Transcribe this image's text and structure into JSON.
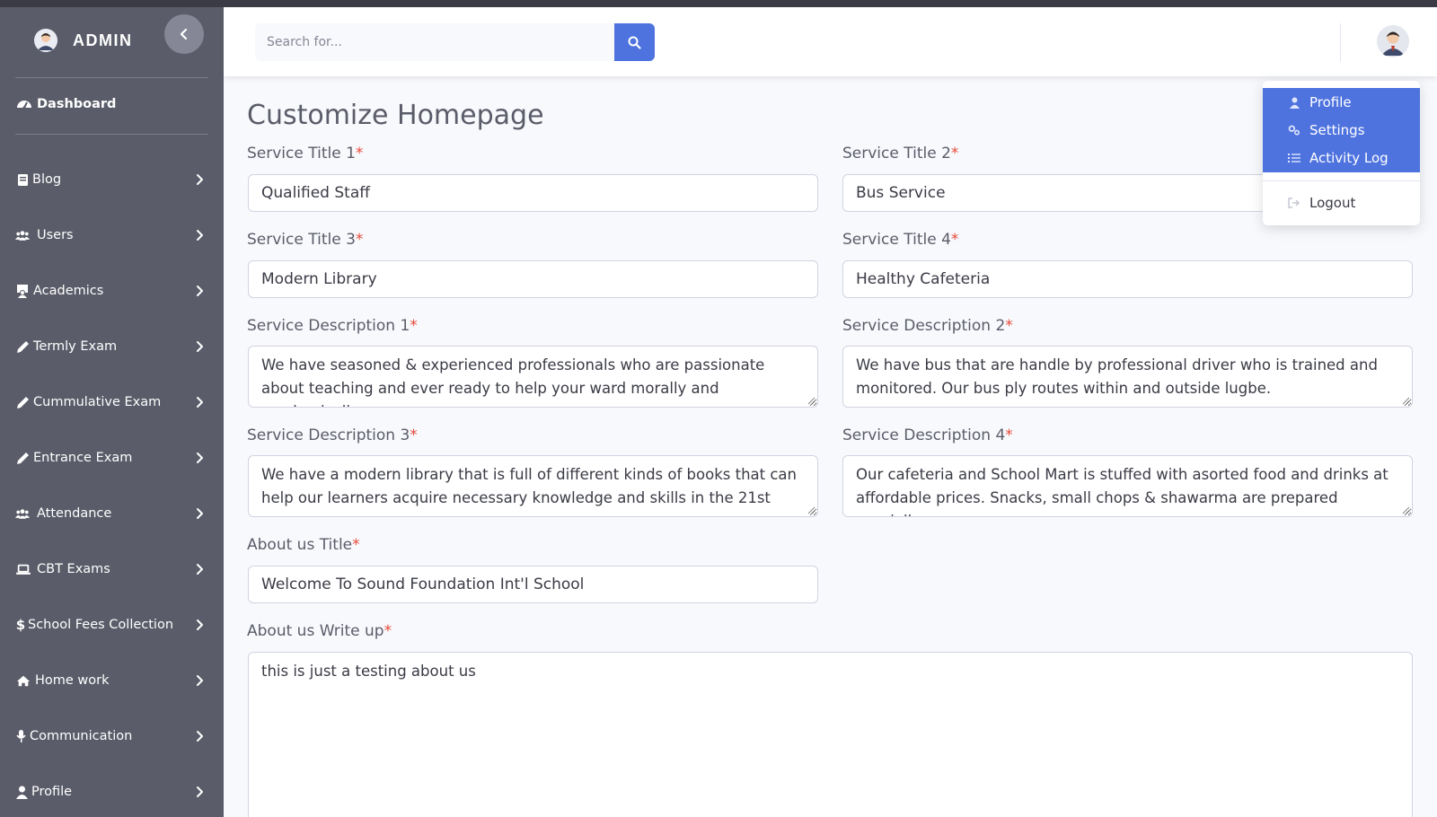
{
  "sidebar": {
    "brand": "ADMIN",
    "dashboard": "Dashboard",
    "items": [
      {
        "label": "Blog",
        "icon": "book-icon"
      },
      {
        "label": "Users",
        "icon": "users-icon"
      },
      {
        "label": "Academics",
        "icon": "teacher-icon"
      },
      {
        "label": "Termly Exam",
        "icon": "pencil-icon"
      },
      {
        "label": "Cummulative Exam",
        "icon": "pencil-icon"
      },
      {
        "label": "Entrance Exam",
        "icon": "pencil-icon"
      },
      {
        "label": "Attendance",
        "icon": "users-icon"
      },
      {
        "label": "CBT Exams",
        "icon": "laptop-icon"
      },
      {
        "label": "School Fees Collection",
        "icon": "dollar-icon"
      },
      {
        "label": "Home work",
        "icon": "home-icon"
      },
      {
        "label": "Communication",
        "icon": "microphone-icon"
      },
      {
        "label": "Profile",
        "icon": "user-icon"
      }
    ]
  },
  "topbar": {
    "search_placeholder": "Search for..."
  },
  "user_menu": {
    "items": [
      {
        "label": "Profile",
        "icon": "user-icon"
      },
      {
        "label": "Settings",
        "icon": "cogs-icon"
      },
      {
        "label": "Activity Log",
        "icon": "list-icon"
      }
    ],
    "logout": "Logout"
  },
  "main": {
    "title": "Customize Homepage",
    "required_mark": "*",
    "fields": {
      "service_title_1": {
        "label": "Service Title 1",
        "value": "Qualified Staff"
      },
      "service_title_2": {
        "label": "Service Title 2",
        "value": "Bus Service"
      },
      "service_title_3": {
        "label": "Service Title 3",
        "value": "Modern Library"
      },
      "service_title_4": {
        "label": "Service Title 4",
        "value": "Healthy Cafeteria"
      },
      "service_desc_1": {
        "label": "Service Description 1",
        "value": "We have seasoned & experienced professionals who are passionate about teaching and ever ready to help your ward morally and academically"
      },
      "service_desc_2": {
        "label": "Service Description 2",
        "value": "We have bus that are handle by professional driver who is trained and monitored. Our bus ply routes within and outside lugbe."
      },
      "service_desc_3": {
        "label": "Service Description 3",
        "value": "We have a modern library that is full of different kinds of books that can help our learners acquire necessary knowledge and skills in the 21st"
      },
      "service_desc_4": {
        "label": "Service Description 4",
        "value": "Our cafeteria and School Mart is stuffed with asorted food and drinks at affordable prices. Snacks, small chops & shawarma are prepared specially."
      },
      "about_title": {
        "label": "About us Title",
        "value": "Welcome To Sound Foundation Int'l School"
      },
      "about_writeup": {
        "label": "About us Write up",
        "value": "this is just a testing about us"
      }
    }
  },
  "colors": {
    "sidebar_bg": "#5a5c69",
    "primary": "#4e73df",
    "required": "#e74a3b"
  }
}
